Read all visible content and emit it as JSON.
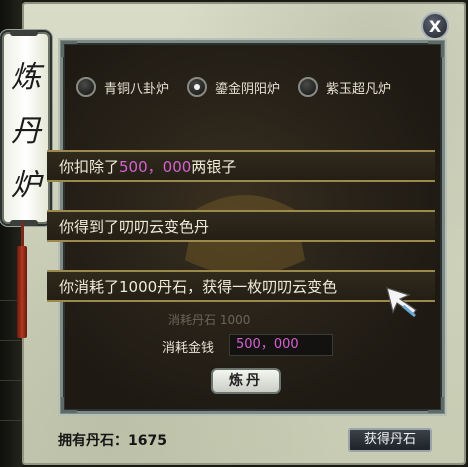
{
  "window": {
    "title_chars": [
      "炼",
      "丹",
      "炉"
    ],
    "close_label": "X"
  },
  "furnace_options": [
    {
      "label": "青铜八卦炉",
      "selected": false
    },
    {
      "label": "鎏金阴阳炉",
      "selected": true
    },
    {
      "label": "紫玉超凡炉",
      "selected": false
    }
  ],
  "messages": {
    "m1_prefix": "你扣除了",
    "m1_amount": "500，000",
    "m1_suffix": "两银子",
    "m2": "你得到了叨叨云变色丹",
    "m3": "你消耗了1000丹石，获得一枚叨叨云变色"
  },
  "faint_cost": "消耗丹石 1000",
  "cost": {
    "label": "消耗金钱",
    "value": "500，000"
  },
  "buttons": {
    "alchemy": "炼丹",
    "obtain": "获得丹石"
  },
  "owned_stones": "拥有丹石：1675",
  "colors": {
    "highlight": "#d760d0",
    "message_border": "#9c8a4c",
    "tassel": "#b03a22"
  }
}
